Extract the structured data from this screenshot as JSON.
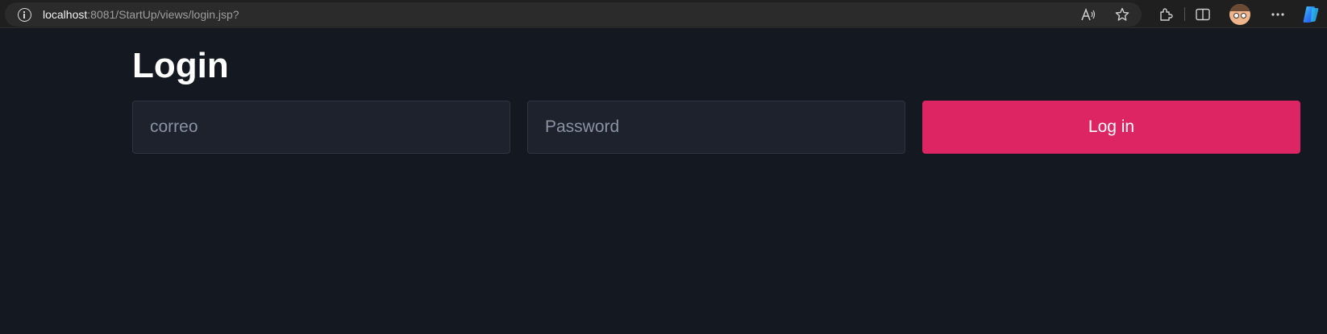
{
  "browser": {
    "url_host": "localhost",
    "url_path": ":8081/StartUp/views/login.jsp?",
    "toolbar_icons": [
      "read-aloud-icon",
      "favorite-star-icon",
      "extensions-icon",
      "split-screen-icon",
      "profile-avatar",
      "more-options-icon",
      "copilot-icon"
    ]
  },
  "page": {
    "title": "Login",
    "email_placeholder": "correo",
    "email_value": "",
    "password_placeholder": "Password",
    "password_value": "",
    "submit_label": "Log in"
  },
  "colors": {
    "background": "#141821",
    "input_background": "#1e222d",
    "input_border": "#2e3442",
    "accent": "#dc2562",
    "title_text": "#ffffff",
    "placeholder_text": "#8a92a3"
  }
}
